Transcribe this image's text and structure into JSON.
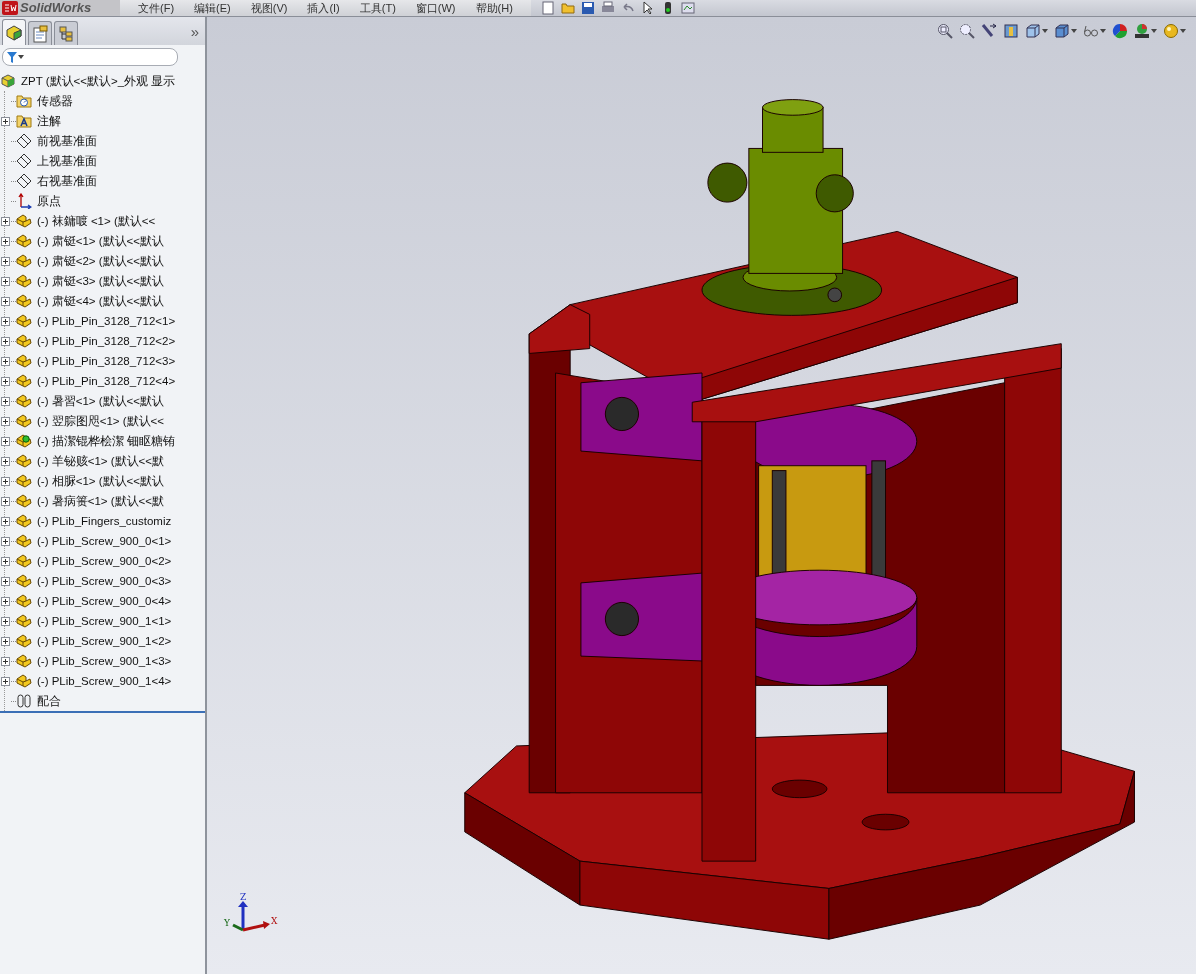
{
  "app": {
    "logo": "SolidWorks"
  },
  "menu": [
    "文件(F)",
    "编辑(E)",
    "视图(V)",
    "插入(I)",
    "工具(T)",
    "窗口(W)",
    "帮助(H)"
  ],
  "panel_tabs": [
    {
      "kind": "feature-tree",
      "selected": true
    },
    {
      "kind": "property",
      "selected": false
    },
    {
      "kind": "configuration",
      "selected": false
    }
  ],
  "panel_more": "»",
  "tree": {
    "kind": "assembly",
    "label": "ZPT  (默认<<默认>_外观 显示",
    "children": [
      {
        "kind": "sensors",
        "label": "传感器",
        "expandable": false
      },
      {
        "kind": "annotations",
        "label": "注解",
        "expandable": true
      },
      {
        "kind": "plane",
        "label": "前视基准面",
        "expandable": false
      },
      {
        "kind": "plane",
        "label": "上视基准面",
        "expandable": false
      },
      {
        "kind": "plane",
        "label": "右视基准面",
        "expandable": false
      },
      {
        "kind": "origin",
        "label": "原点",
        "expandable": false
      },
      {
        "kind": "part",
        "label": "(-) 袜鏞喥   <1> (默认<<",
        "expandable": true
      },
      {
        "kind": "part",
        "label": "(-) 肃铤<1> (默认<<默认",
        "expandable": true
      },
      {
        "kind": "part",
        "label": "(-) 肃铤<2> (默认<<默认",
        "expandable": true
      },
      {
        "kind": "part",
        "label": "(-) 肃铤<3> (默认<<默认",
        "expandable": true
      },
      {
        "kind": "part",
        "label": "(-) 肃铤<4> (默认<<默认",
        "expandable": true
      },
      {
        "kind": "part",
        "label": "(-) PLib_Pin_3128_712<1>",
        "expandable": true
      },
      {
        "kind": "part",
        "label": "(-) PLib_Pin_3128_712<2>",
        "expandable": true
      },
      {
        "kind": "part",
        "label": "(-) PLib_Pin_3128_712<3>",
        "expandable": true
      },
      {
        "kind": "part",
        "label": "(-) PLib_Pin_3128_712<4>",
        "expandable": true
      },
      {
        "kind": "part",
        "label": "(-) 暑習<1> (默认<<默认",
        "expandable": true
      },
      {
        "kind": "part",
        "label": "(-) 翌腙图咫<1> (默认<<",
        "expandable": true
      },
      {
        "kind": "subassembly",
        "label": "(-) 描潔锟桦桧潔 钿眍糖铕",
        "expandable": true
      },
      {
        "kind": "part",
        "label": "(-) 羊铋赅<1> (默认<<默",
        "expandable": true
      },
      {
        "kind": "part",
        "label": "(-) 相脲<1> (默认<<默认",
        "expandable": true
      },
      {
        "kind": "part",
        "label": "(-) 暑病篑<1> (默认<<默",
        "expandable": true
      },
      {
        "kind": "part",
        "label": "(-) PLib_Fingers_customiz",
        "expandable": true
      },
      {
        "kind": "part",
        "label": "(-) PLib_Screw_900_0<1>",
        "expandable": true
      },
      {
        "kind": "part",
        "label": "(-) PLib_Screw_900_0<2>",
        "expandable": true
      },
      {
        "kind": "part",
        "label": "(-) PLib_Screw_900_0<3>",
        "expandable": true
      },
      {
        "kind": "part",
        "label": "(-) PLib_Screw_900_0<4>",
        "expandable": true
      },
      {
        "kind": "part",
        "label": "(-) PLib_Screw_900_1<1>",
        "expandable": true
      },
      {
        "kind": "part",
        "label": "(-) PLib_Screw_900_1<2>",
        "expandable": true
      },
      {
        "kind": "part",
        "label": "(-) PLib_Screw_900_1<3>",
        "expandable": true
      },
      {
        "kind": "part",
        "label": "(-) PLib_Screw_900_1<4>",
        "expandable": true
      },
      {
        "kind": "mates",
        "label": "配合",
        "expandable": false
      }
    ]
  },
  "triad": {
    "x": "X",
    "y": "Y",
    "z": "Z"
  }
}
